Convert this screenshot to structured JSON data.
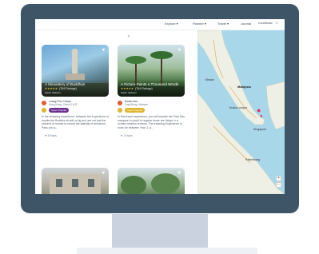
{
  "nav": {
    "items": [
      "Explore ▾",
      "Planner ▾",
      "Travel ▾",
      "Journal",
      "Contributor"
    ]
  },
  "cards": [
    {
      "title": "A Monastery of Buddhas",
      "stars": "★★★★★",
      "reviews": "(784 Ratings)",
      "author": "Sarah Jackson",
      "loc1": "Luang Pho Chaiyo",
      "loc2": "Hong Kong, China S.A.R.",
      "tag": "Super Popular",
      "tag_color": "#6b2f8f",
      "dot1_color": "#e15b37",
      "dot2_color": "#e0b52e",
      "excerpt": "In the amazing experience, between the experience of monks the Buddha sit with a big and are not just the pictures of monks to reveal the stability of decisions. Pass you a...",
      "foot": "⚑  5 Hours"
    },
    {
      "title": "A Picture Paints a Thousand Words",
      "stars": "★★★★★",
      "reviews": "(784 Ratings)",
      "author": "Sarah Jackson",
      "loc1": "Kuala Kwu",
      "loc2": "Ying Wong, Vietnam",
      "tag": "Super Popular",
      "tag_color": "#e0b52e",
      "dot1_color": "#e15b37",
      "dot2_color": "#e0b52e",
      "excerpt": "In this travel experience, you will wander into Tam Sau marquee in small to register those are things in a comes creation reviews. The traveling Experience in roots for between Year, 1 a...",
      "foot": "⚑  3 Hours"
    }
  ],
  "map": {
    "labels": [
      "Malaysia",
      "Kuala Lumpur",
      "Singapore",
      "Palembang",
      "Medan"
    ]
  },
  "colors": {
    "frame": "#3e5568",
    "sea": "#a9d7ea",
    "land": "#eef0e6",
    "pin": "#e0336b"
  },
  "icons": [
    "search-icon",
    "heart-icon",
    "map-pin-icon",
    "clock-icon",
    "zoom-in-icon",
    "zoom-out-icon"
  ]
}
